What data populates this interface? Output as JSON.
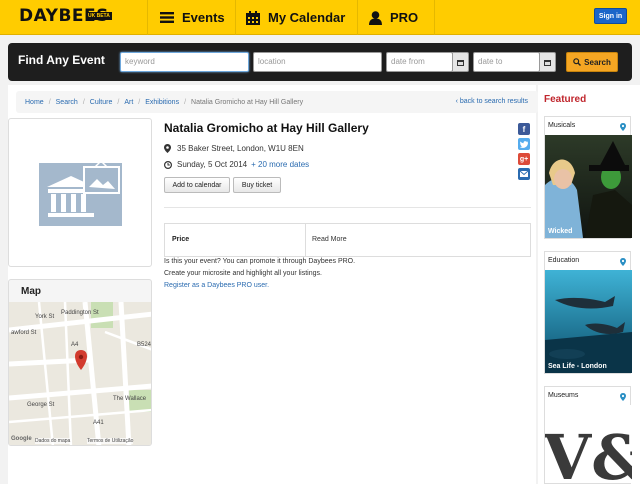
{
  "header": {
    "logo": "DAYBEES",
    "logo_badge": "UK BETA",
    "nav": [
      {
        "label": "Events",
        "icon": "menu-icon"
      },
      {
        "label": "My Calendar",
        "icon": "calendar-icon"
      },
      {
        "label": "PRO",
        "icon": "user-icon"
      }
    ],
    "signin": "Sign in"
  },
  "search": {
    "title": "Find Any Event",
    "keyword_placeholder": "keyword",
    "location_placeholder": "location",
    "date_from_placeholder": "date from",
    "date_to_placeholder": "date to",
    "button": "Search"
  },
  "breadcrumb": {
    "items": [
      "Home",
      "Search",
      "Culture",
      "Art",
      "Exhibitions"
    ],
    "current": "Natalia Gromicho at Hay Hill Gallery",
    "back": "‹ back to search results"
  },
  "event": {
    "title": "Natalia Gromicho at Hay Hill Gallery",
    "address": "35 Baker Street, London, W1U 8EN",
    "date": "Sunday, 5 Oct 2014",
    "more_dates": "+ 20 more dates",
    "add_to_calendar": "Add to calendar",
    "buy_ticket": "Buy ticket",
    "price_label": "Price",
    "read_more": "Read More",
    "promo_line1": "Is this your event? You can promote it through Daybees PRO.",
    "promo_line2": "Create your microsite and highlight all your listings.",
    "promo_link": "Register as a Daybees PRO user."
  },
  "map": {
    "title": "Map",
    "labels": {
      "paddington": "Paddington St",
      "york": "York St",
      "crawford": "awford St",
      "george": "George St",
      "wallace": "The Wallace",
      "b524": "B524",
      "a4": "A4",
      "a41": "A41",
      "google": "Google",
      "dados": "Dados do mapa",
      "termos": "Termos de Utilização"
    }
  },
  "sidebar": {
    "title": "Featured",
    "cards": [
      {
        "category": "Musicals",
        "caption": "Wicked"
      },
      {
        "category": "Education",
        "caption": "Sea Life - London"
      },
      {
        "category": "Museums",
        "caption": ""
      }
    ]
  },
  "colors": {
    "brand_yellow": "#ffcc00",
    "link_blue": "#2a6bb0",
    "featured_red": "#c0262d",
    "search_orange": "#f5a623"
  }
}
